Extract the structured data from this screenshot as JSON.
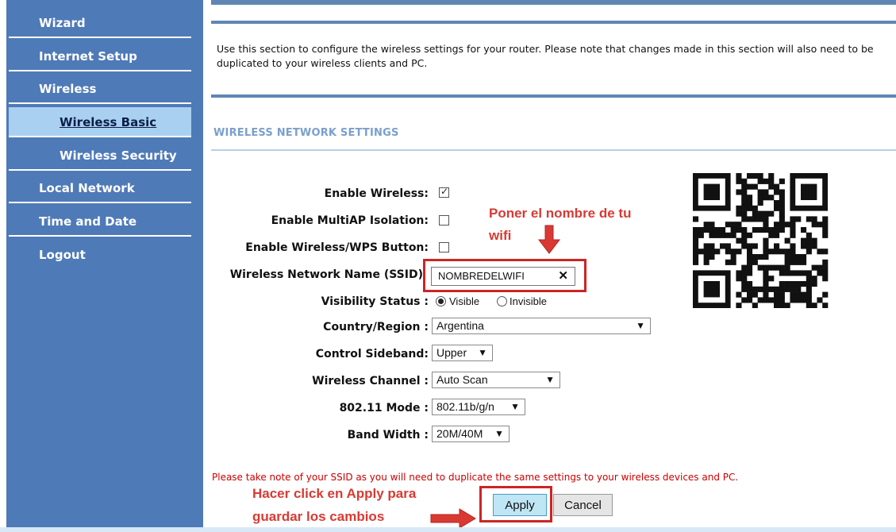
{
  "sidebar": {
    "items": [
      {
        "label": "Wizard"
      },
      {
        "label": "Internet Setup"
      },
      {
        "label": "Wireless"
      },
      {
        "label": "Wireless Basic"
      },
      {
        "label": "Wireless Security"
      },
      {
        "label": "Local Network"
      },
      {
        "label": "Time and Date"
      },
      {
        "label": "Logout"
      }
    ]
  },
  "main": {
    "intro": "Use this section to configure the wireless settings for your router. Please note that changes made in this section will also need to be duplicated to your wireless clients and PC.",
    "section_title": "WIRELESS NETWORK SETTINGS",
    "fields": {
      "enable_wireless": {
        "label": "Enable Wireless:",
        "checked": true
      },
      "multiap": {
        "label": "Enable MultiAP Isolation:",
        "checked": false
      },
      "wps_button": {
        "label": "Enable Wireless/WPS Button:",
        "checked": false
      },
      "ssid": {
        "label": "Wireless Network Name (SSID)",
        "value": "NOMBREDELWIFI",
        "clear": "✕"
      },
      "visibility": {
        "label": "Visibility Status :",
        "visible": "Visible",
        "invisible": "Invisible",
        "selected": "Visible"
      },
      "country": {
        "label": "Country/Region :",
        "value": "Argentina"
      },
      "sideband": {
        "label": "Control Sideband:",
        "value": "Upper"
      },
      "channel": {
        "label": "Wireless Channel :",
        "value": "Auto Scan"
      },
      "mode": {
        "label": "802.11 Mode :",
        "value": "802.11b/g/n"
      },
      "bandwidth": {
        "label": "Band Width :",
        "value": "20M/40M"
      }
    },
    "note": "Please take note of your SSID as you will need to duplicate the same settings to your wireless devices and PC.",
    "apply_label": "Apply",
    "cancel_label": "Cancel"
  },
  "annotations": {
    "ssid_hint_line1": "Poner el nombre de tu",
    "ssid_hint_line2": "wifi",
    "apply_hint_line1": "Hacer click en Apply para",
    "apply_hint_line2": "guardar los cambios"
  },
  "colors": {
    "sidebar_bg": "#4f7ab8",
    "sidebar_active": "#a9d0f0",
    "accent_rule": "#5f86b5",
    "annotation_red": "#d83a33"
  }
}
